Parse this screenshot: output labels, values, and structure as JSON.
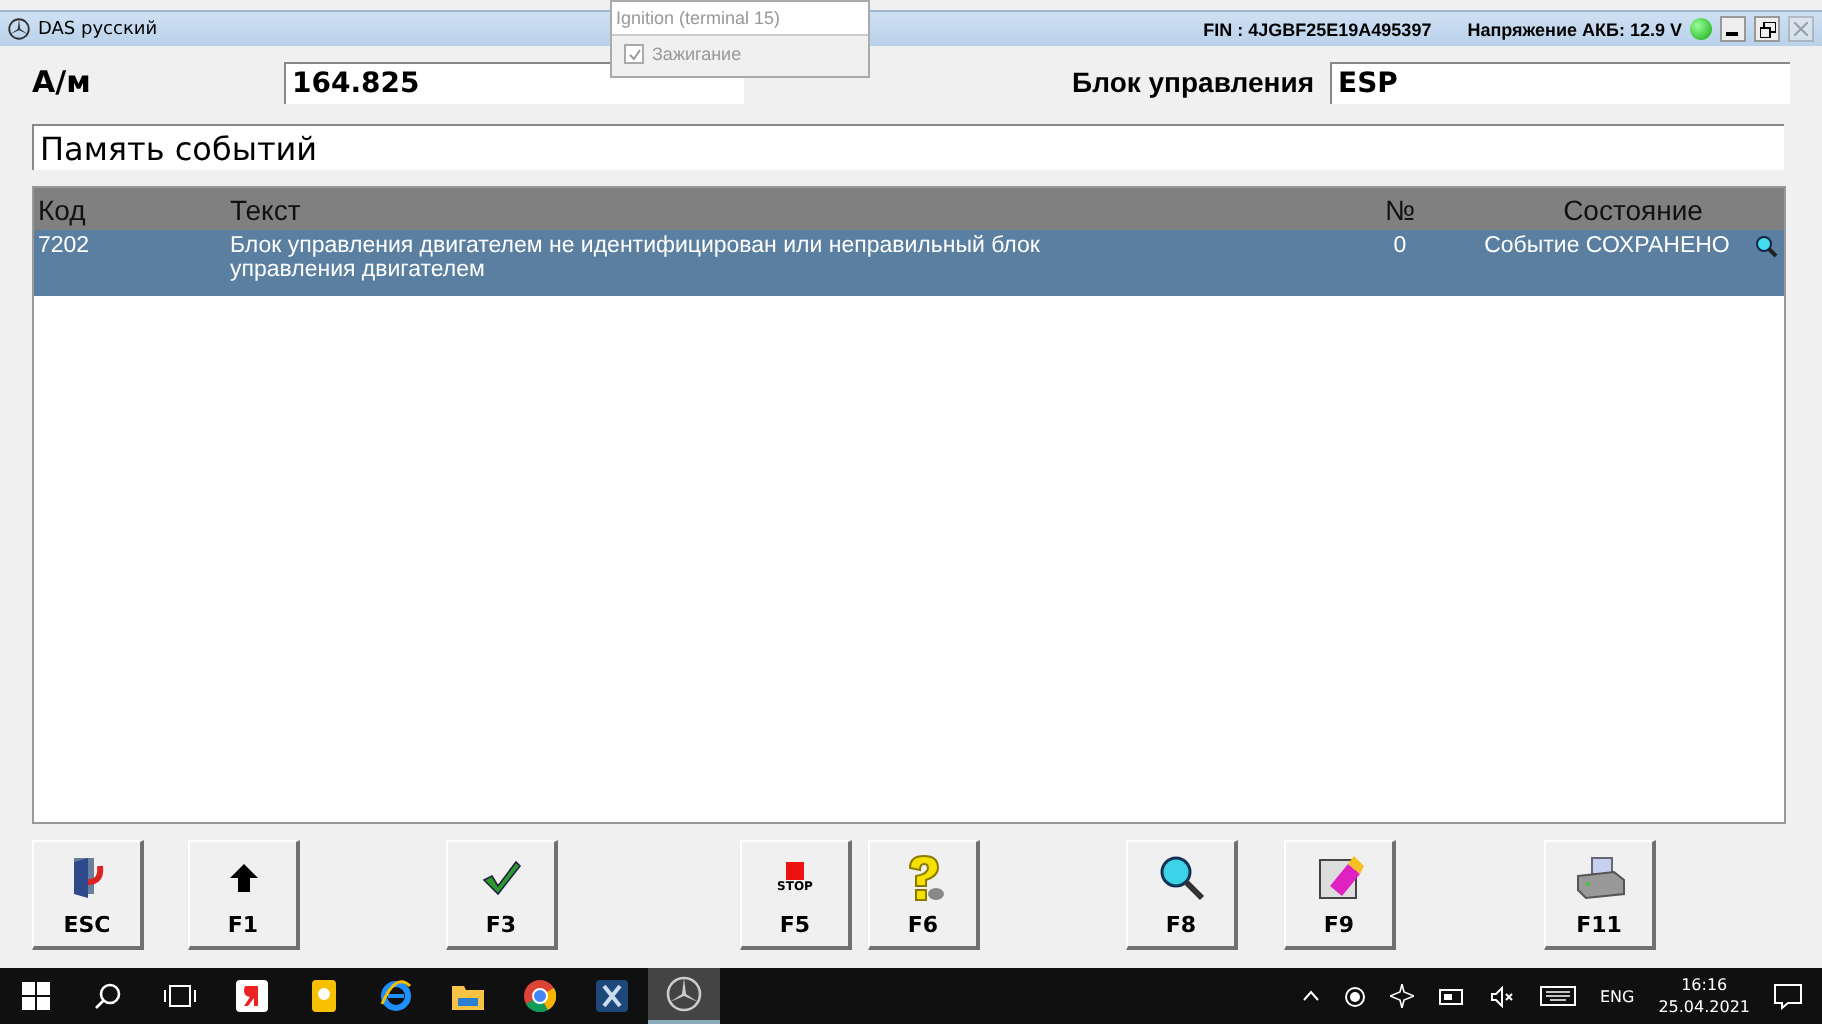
{
  "window": {
    "title": "DAS русский",
    "fin": "FIN : 4JGBF25E19A495397",
    "battery_voltage": "Напряжение АКБ: 12.9 V",
    "battery_ok": true
  },
  "popup": {
    "title": "Ignition (terminal 15)",
    "checkbox": {
      "label": "Зажигание",
      "checked": true,
      "disabled": true
    }
  },
  "fields": {
    "am_label": "А/м",
    "am_value": "164.825",
    "unit_label": "Блок управления",
    "unit_value": "ESP",
    "section": "Память событий"
  },
  "table": {
    "columns": [
      "Код",
      "Текст",
      "№",
      "Состояние"
    ],
    "rows": [
      {
        "code": "7202",
        "text": "Блок управления двигателем не идентифицирован или неправильный блок управления двигателем",
        "count": "0",
        "state": "Событие СОХРАНЕНО",
        "selected": true
      }
    ]
  },
  "function_keys": [
    {
      "label": "ESC",
      "kind": "exit"
    },
    {
      "label": "F1",
      "kind": "up"
    },
    {
      "label": "F3",
      "kind": "check"
    },
    {
      "label": "F5",
      "kind": "stop",
      "caption": "STOP"
    },
    {
      "label": "F6",
      "kind": "help"
    },
    {
      "label": "F8",
      "kind": "search"
    },
    {
      "label": "F9",
      "kind": "erase"
    },
    {
      "label": "F11",
      "kind": "print"
    }
  ],
  "taskbar": {
    "apps": [
      {
        "kind": "yandex",
        "selected": false
      },
      {
        "kind": "note",
        "selected": false
      },
      {
        "kind": "ie",
        "selected": false
      },
      {
        "kind": "folder",
        "selected": false
      },
      {
        "kind": "chrome",
        "selected": false
      },
      {
        "kind": "xapp",
        "selected": false
      },
      {
        "kind": "star",
        "selected": true
      }
    ],
    "language": "ENG",
    "time": "16:16",
    "date": "25.04.2021"
  }
}
